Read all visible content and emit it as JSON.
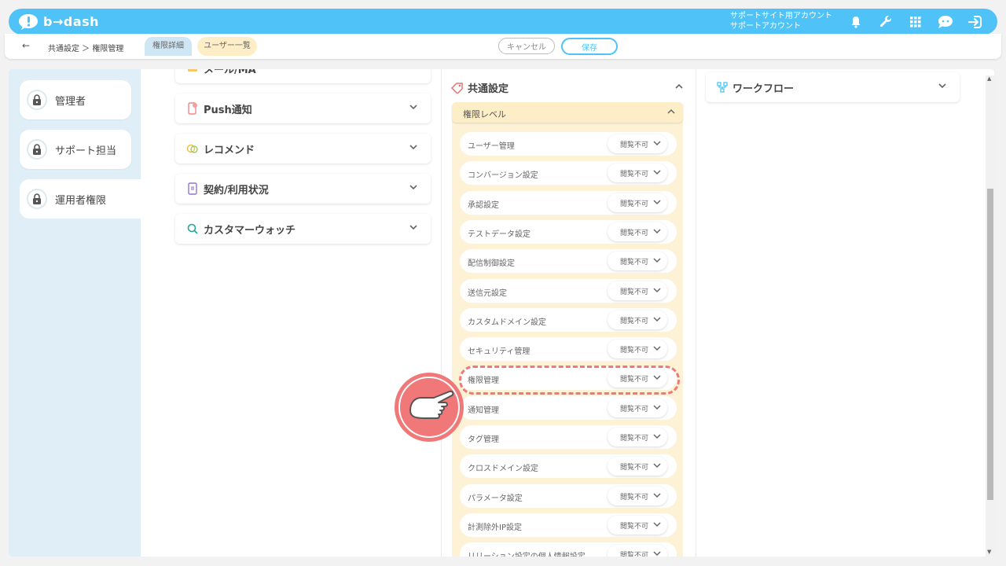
{
  "header": {
    "logo_text": "b→dash",
    "account_line1": "サポートサイト用アカウント",
    "account_line2": "サポートアカウント"
  },
  "subbar": {
    "back": "←",
    "breadcrumb": "共通設定 ＞ 権限管理",
    "tab_detail": "権限詳細",
    "tab_users": "ユーザー一覧",
    "cancel": "キャンセル",
    "save": "保存"
  },
  "sidebar": {
    "items": [
      {
        "label": "管理者"
      },
      {
        "label": "サポート担当"
      },
      {
        "label": "運用者権限"
      }
    ]
  },
  "col1": {
    "items": [
      {
        "label": "メール/MA"
      },
      {
        "label": "Push通知"
      },
      {
        "label": "レコメンド"
      },
      {
        "label": "契約/利用状況"
      },
      {
        "label": "カスタマーウォッチ"
      }
    ]
  },
  "common": {
    "title": "共通設定",
    "level_label": "権限レベル",
    "rows": [
      {
        "label": "ユーザー管理",
        "value": "閲覧不可"
      },
      {
        "label": "コンバージョン設定",
        "value": "閲覧不可"
      },
      {
        "label": "承認設定",
        "value": "閲覧不可"
      },
      {
        "label": "テストデータ設定",
        "value": "閲覧不可"
      },
      {
        "label": "配信制御設定",
        "value": "閲覧不可"
      },
      {
        "label": "送信元設定",
        "value": "閲覧不可"
      },
      {
        "label": "カスタムドメイン設定",
        "value": "閲覧不可"
      },
      {
        "label": "セキュリティ管理",
        "value": "閲覧不可"
      },
      {
        "label": "権限管理",
        "value": "閲覧不可"
      },
      {
        "label": "通知管理",
        "value": "閲覧不可"
      },
      {
        "label": "タグ管理",
        "value": "閲覧不可"
      },
      {
        "label": "クロスドメイン設定",
        "value": "閲覧不可"
      },
      {
        "label": "パラメータ設定",
        "value": "閲覧不可"
      },
      {
        "label": "計測除外IP設定",
        "value": "閲覧不可"
      },
      {
        "label": "リリーション設定の個人情報設定",
        "value": "閲覧不可"
      }
    ]
  },
  "workflow": {
    "title": "ワークフロー"
  },
  "colors": {
    "brand": "#4fc3f7",
    "highlight": "#f07878",
    "level_bg": "#fdf2d6"
  }
}
